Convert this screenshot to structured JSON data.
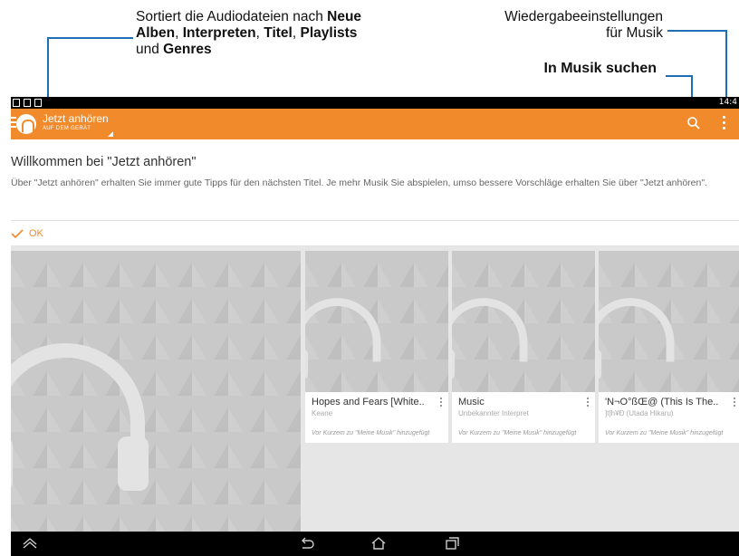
{
  "callouts": {
    "sort": {
      "line1_prefix": "Sortiert die Audiodateien nach ",
      "line1_bold": "Neue",
      "line2_bold_a": "Alben",
      "sep1": ", ",
      "line2_bold_b": "Interpreten",
      "sep2": ", ",
      "line2_bold_c": "Titel",
      "sep3": ", ",
      "line2_bold_d": "Playlists",
      "line3_prefix": "und ",
      "line3_bold": "Genres"
    },
    "settings": {
      "line1": "Wiedergabeeinstellungen",
      "line2": "für Musik"
    },
    "search": {
      "text": "In Musik suchen"
    },
    "line_color": "#1e6fb6"
  },
  "status_bar": {
    "clock": "14:4"
  },
  "action_bar": {
    "title": "Jetzt anhören",
    "subtitle": "AUF DEM GERÄT",
    "accent": "#f08a2a",
    "icons": [
      "menu-icon",
      "headphones-logo-icon",
      "search-icon",
      "overflow-menu-icon"
    ]
  },
  "welcome": {
    "title": "Willkommen bei \"Jetzt anhören\"",
    "body": "Über \"Jetzt anhören\" erhalten Sie immer gute Tipps für den nächsten Titel. Je mehr Musik Sie abspielen, umso bessere Vorschläge erhalten Sie über \"Jetzt anhören\".",
    "ok_label": "OK"
  },
  "cards": [
    {
      "title": "Hopes and Fears [White..",
      "subtitle": "Keane",
      "note": "Vor Kurzem zu \"Meine Musik\" hinzugefügt"
    },
    {
      "title": "Music",
      "subtitle": "Unbekannter Interpret",
      "note": "Vor Kurzem zu \"Meine Musik\" hinzugefügt"
    },
    {
      "title": "'N¬O°ßŒ@ (This Is The..",
      "subtitle": "]t]h¥Ð (Utada Hikaru)",
      "note": "Vor Kurzem zu \"Meine Musik\" hinzugefügt"
    }
  ],
  "nav_bar": {
    "icons": [
      "collapse-icon",
      "back-icon",
      "home-icon",
      "recent-apps-icon"
    ]
  }
}
